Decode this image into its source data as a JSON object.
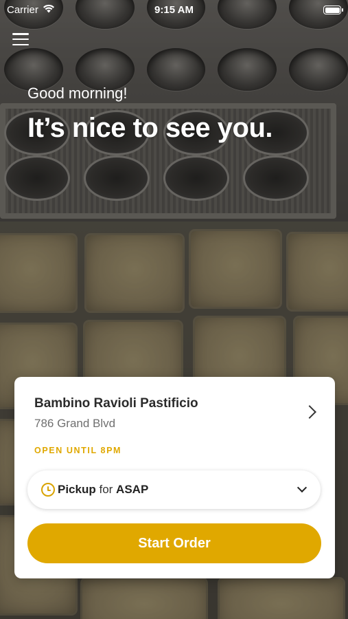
{
  "status_bar": {
    "carrier": "Carrier",
    "time": "9:15 AM",
    "wifi_icon": "wifi-icon",
    "battery_icon": "battery-icon"
  },
  "header": {
    "menu_icon": "hamburger-menu-icon",
    "greeting": "Good morning!",
    "headline": "It’s nice to see you."
  },
  "store_card": {
    "name": "Bambino Ravioli Pastificio",
    "address": "786 Grand Blvd",
    "hours_status": "OPEN UNTIL 8PM",
    "chevron_icon": "chevron-right-icon",
    "order_mode": {
      "type": "Pickup",
      "connector": " for ",
      "time": "ASAP",
      "icon": "clock-icon",
      "dropdown_icon": "chevron-down-icon"
    },
    "primary_button": "Start Order"
  },
  "colors": {
    "accent": "#e0a800",
    "card_background": "#ffffff",
    "text_primary": "#2b2b2b",
    "text_secondary": "#6f6f6f"
  }
}
